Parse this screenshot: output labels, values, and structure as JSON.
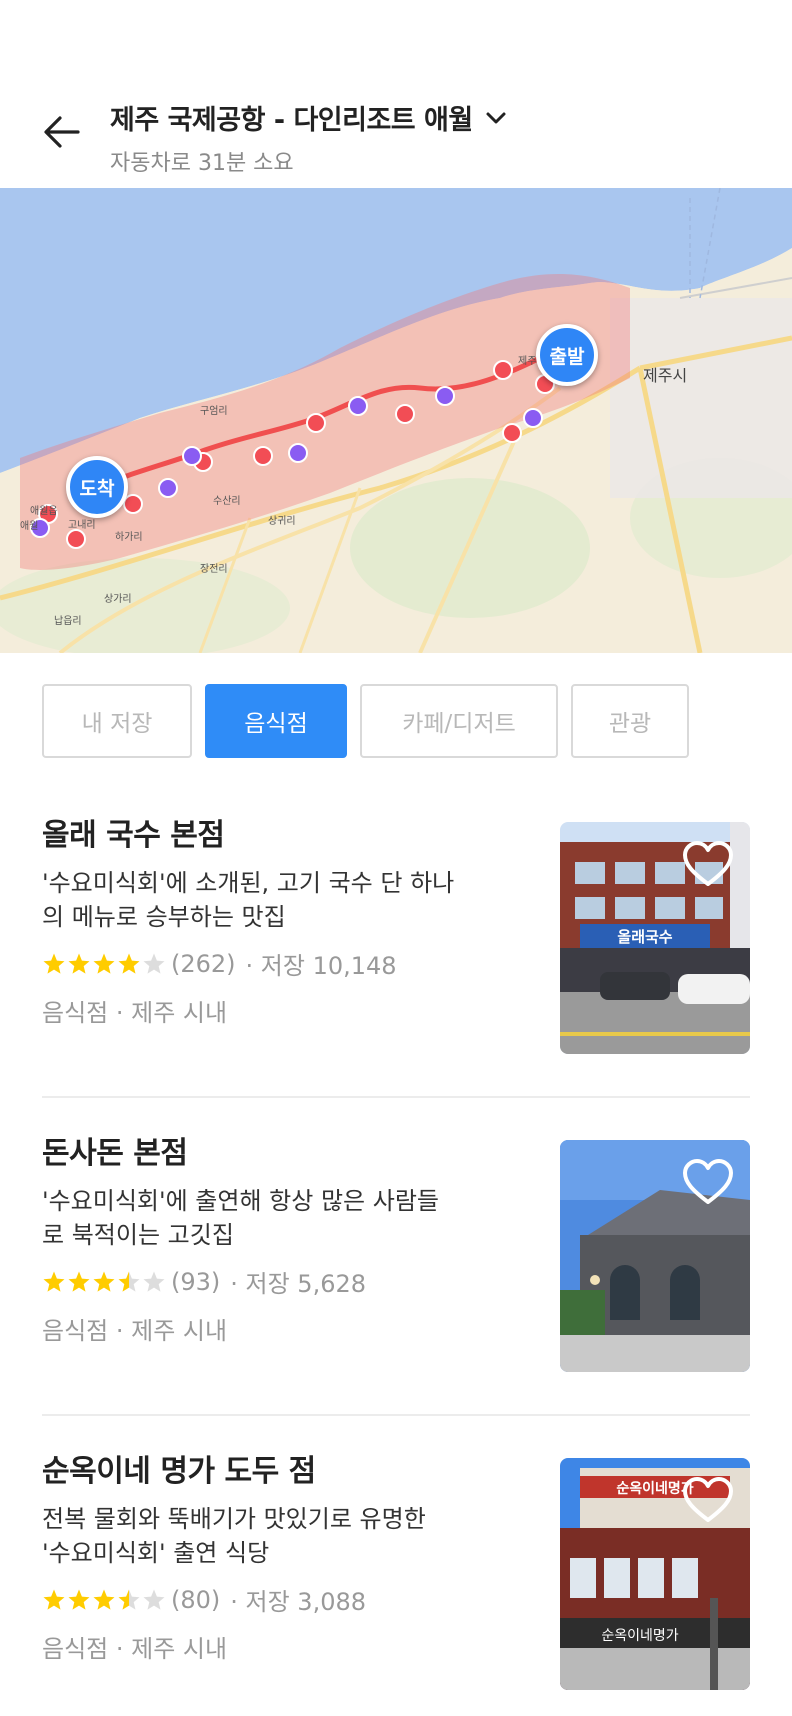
{
  "header": {
    "title": "제주 국제공항 - 다인리조트 애월",
    "subtitle": "자동차로 31분 소요"
  },
  "map": {
    "start_label": "출발",
    "end_label": "도착",
    "city_label": "제주시",
    "place_labels": [
      "제주",
      "구엄리",
      "수산리",
      "상귀리",
      "하가리",
      "고내리",
      "장전리",
      "상가리",
      "납읍리",
      "애월읍",
      "애월"
    ],
    "route_color": "#f04f4f",
    "restaurant_dot_color": "#f24d55",
    "poi_dot_color": "#8a5cf2"
  },
  "chips": [
    {
      "label": "내 저장",
      "active": false
    },
    {
      "label": "음식점",
      "active": true
    },
    {
      "label": "카페/디저트",
      "active": false
    },
    {
      "label": "관광",
      "active": false
    }
  ],
  "items": [
    {
      "name": "올래 국수 본점",
      "desc_line1": "'수요미식회'에 소개된, 고기 국수 단 하나",
      "desc_line2": "의 메뉴로 승부하는 맛집",
      "rating": 4.0,
      "reviews": "(262)",
      "saves": "· 저장 10,148",
      "category": "음식점 · 제주 시내",
      "sign_text": "올래국수"
    },
    {
      "name": "돈사돈 본점",
      "desc_line1": "'수요미식회'에 출연해 항상 많은 사람들",
      "desc_line2": "로 북적이는 고깃집",
      "rating": 3.5,
      "reviews": "(93)",
      "saves": "· 저장 5,628",
      "category": "음식점 · 제주 시내",
      "sign_text": ""
    },
    {
      "name": "순옥이네 명가 도두 점",
      "desc_line1": "전복 물회와 뚝배기가 맛있기로 유명한",
      "desc_line2": "'수요미식회' 출연 식당",
      "rating": 3.5,
      "reviews": "(80)",
      "saves": "· 저장 3,088",
      "category": "음식점 · 제주 시내",
      "sign_text": "순옥이네명가"
    }
  ],
  "colors": {
    "accent": "#2f8cf7",
    "star_filled": "#ffcc00",
    "star_empty": "#dddddd"
  }
}
